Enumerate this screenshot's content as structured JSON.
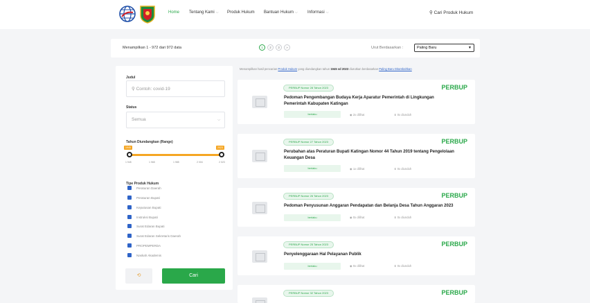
{
  "header": {
    "nav": [
      {
        "label": "Home",
        "active": true,
        "dropdown": false
      },
      {
        "label": "Tentang Kami",
        "active": false,
        "dropdown": true
      },
      {
        "label": "Produk Hukum",
        "active": false,
        "dropdown": false
      },
      {
        "label": "Bantuan Hukum",
        "active": false,
        "dropdown": true
      },
      {
        "label": "Informasi",
        "active": false,
        "dropdown": true
      }
    ],
    "search_label": "Cari Produk Hukum"
  },
  "toolbar": {
    "showing": "Menampilkan 1 - 972 dari 972 data",
    "pages": [
      "1",
      "2",
      "3",
      "»"
    ],
    "active_page": "1",
    "sort_label": "Urut Berdasarkan :",
    "sort_value": "Paling Baru"
  },
  "filters": {
    "judul_label": "Judul",
    "judul_placeholder": "Contoh: covid-19",
    "status_label": "Status",
    "status_value": "Semua",
    "year_label": "Tahun Diundangkan (Range)",
    "year_min": "1945",
    "year_max": "2023",
    "year_ticks": [
      "1 945",
      "1 965",
      "1 985",
      "2 004",
      "2 023"
    ],
    "type_label": "Tipe Produk Hukum",
    "types": [
      "Peraturan Daerah",
      "Peraturan Bupati",
      "Keputusan Bupati",
      "Instruksi Bupati",
      "Surat Edaran Bupati",
      "Surat Edaran Sekretaris Daerah",
      "PROPEMPERDA",
      "Naskah Akademis"
    ],
    "reset_icon": "⟲",
    "search_button": "Cari"
  },
  "results": {
    "info_prefix": "Menampilkan hasil pencarian",
    "info_link1": "Produk Hukum",
    "info_mid": "yang diundangkan tahun",
    "info_range": "1945 sd 2023",
    "info_suffix": "diurutkan berdasarkan",
    "info_link2": "Paling Baru Ditambahkan",
    "items": [
      {
        "number": "PERBUP Nomor 28 Tahun 2023",
        "type": "PERBUP",
        "title": "Pedoman Pengembangan Budaya Kerja Aparatur Pemerintah di Lingkungan Pemerintah Kabupaten Katingan",
        "status": "berlaku",
        "views": "2x dilihat",
        "downloads": "0x diunduh"
      },
      {
        "number": "PERBUP Nomor 27 Tahun 2023",
        "type": "PERBUP",
        "title": "Perubahan atas Peraturan Bupati Katingan Nomor 44 Tahun 2019 tentang Pengelolaan Keuangan Desa",
        "status": "berlaku",
        "views": "1x dilihat",
        "downloads": "0x diunduh"
      },
      {
        "number": "PERBUP Nomor 26 Tahun 2023",
        "type": "PERBUP",
        "title": "Pedoman Penyusunan Anggaran Pendapatan dan Belanja Desa Tahun Anggaran 2023",
        "status": "berlaku",
        "views": "0x dilihat",
        "downloads": "0x diunduh"
      },
      {
        "number": "PERBUP Nomor 25 Tahun 2023",
        "type": "PERBUP",
        "title": "Penyelenggaraan Hal Pelayanan Publik",
        "status": "berlaku",
        "views": "0x dilihat",
        "downloads": "0x diunduh"
      },
      {
        "number": "PERBUP Nomor 32 Tahun 2023",
        "type": "PERBUP",
        "title": "",
        "status": "",
        "views": "",
        "downloads": ""
      }
    ]
  },
  "colors": {
    "accent": "#2aa84a",
    "slider": "#f5a623",
    "checkbox": "#2f64c8"
  }
}
